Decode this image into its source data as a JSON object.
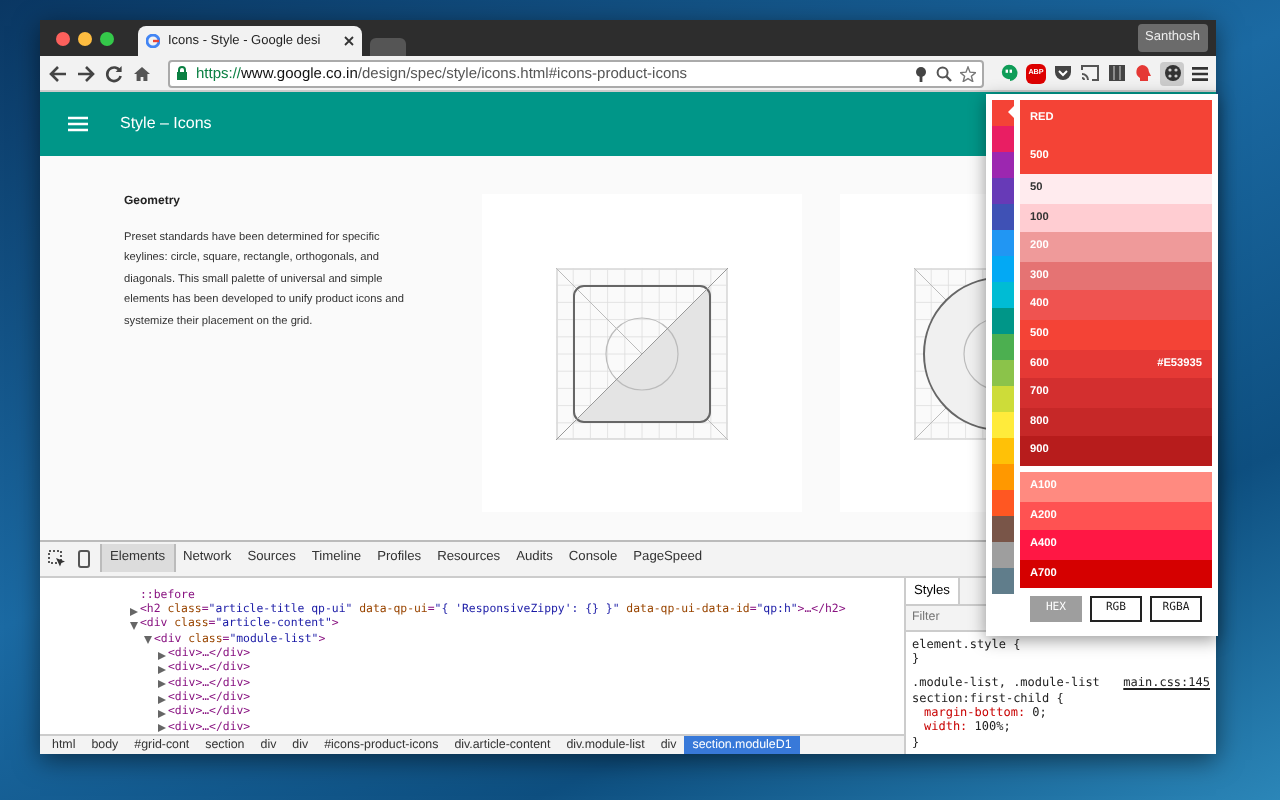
{
  "window": {
    "tab_title": "Icons - Style - Google desi",
    "profile": "Santhosh"
  },
  "toolbar": {
    "url": [
      {
        "kind": "scheme",
        "text": "https://"
      },
      {
        "kind": "host",
        "text": "www.google.co.in"
      },
      {
        "kind": "path",
        "text": "/design/spec/style/icons.html#icons-product-icons"
      }
    ],
    "adblock_badge": "ABP"
  },
  "page": {
    "header_title": "Style – Icons",
    "heading": "Geometry",
    "paragraph": "Preset standards have been determined for specific keylines: circle, square, rectangle, orthogonals, and diagonals. This small palette of universal and simple elements has been developed to unify product icons and systemize their placement on the grid."
  },
  "devtools": {
    "tabs": [
      {
        "label": "Elements",
        "selected": true
      },
      {
        "label": "Network",
        "selected": false
      },
      {
        "label": "Sources",
        "selected": false
      },
      {
        "label": "Timeline",
        "selected": false
      },
      {
        "label": "Profiles",
        "selected": false
      },
      {
        "label": "Resources",
        "selected": false
      },
      {
        "label": "Audits",
        "selected": false
      },
      {
        "label": "Console",
        "selected": false
      },
      {
        "label": "PageSpeed",
        "selected": false
      }
    ],
    "dom_tree": [
      {
        "parts": [
          {
            "kind": "pseudo",
            "text": "::before"
          }
        ]
      },
      {
        "expanded": false,
        "parts": [
          {
            "kind": "tag",
            "text": "<h2"
          },
          {
            "kind": "attr",
            "text": " class"
          },
          {
            "kind": "tag",
            "text": "="
          },
          {
            "kind": "val",
            "text": "\"article-title qp-ui\""
          },
          {
            "kind": "attr",
            "text": " data-qp-ui"
          },
          {
            "kind": "tag",
            "text": "="
          },
          {
            "kind": "val",
            "text": "\"{ 'ResponsiveZippy': {} }\""
          },
          {
            "kind": "attr",
            "text": " data-qp-ui-data-id"
          },
          {
            "kind": "tag",
            "text": "="
          },
          {
            "kind": "val",
            "text": "\"qp:h\""
          },
          {
            "kind": "tag",
            "text": ">…</h2>"
          }
        ]
      },
      {
        "expanded": true,
        "parts": [
          {
            "kind": "tag",
            "text": "<div"
          },
          {
            "kind": "attr",
            "text": " class"
          },
          {
            "kind": "tag",
            "text": "="
          },
          {
            "kind": "val",
            "text": "\"article-content\""
          },
          {
            "kind": "tag",
            "text": ">"
          }
        ],
        "children": [
          {
            "expanded": true,
            "parts": [
              {
                "kind": "tag",
                "text": "<div"
              },
              {
                "kind": "attr",
                "text": " class"
              },
              {
                "kind": "tag",
                "text": "="
              },
              {
                "kind": "val",
                "text": "\"module-list\""
              },
              {
                "kind": "tag",
                "text": ">"
              }
            ],
            "children": [
              {
                "expanded": false,
                "parts": [
                  {
                    "kind": "tag",
                    "text": "<div>…</div>"
                  }
                ]
              },
              {
                "expanded": false,
                "parts": [
                  {
                    "kind": "tag",
                    "text": "<div>…</div>"
                  }
                ]
              },
              {
                "expanded": false,
                "parts": [
                  {
                    "kind": "tag",
                    "text": "<div>…</div>"
                  }
                ]
              },
              {
                "expanded": false,
                "parts": [
                  {
                    "kind": "tag",
                    "text": "<div>…</div>"
                  }
                ]
              },
              {
                "expanded": false,
                "parts": [
                  {
                    "kind": "tag",
                    "text": "<div>…</div>"
                  }
                ]
              },
              {
                "expanded": false,
                "parts": [
                  {
                    "kind": "tag",
                    "text": "<div>…</div>"
                  }
                ]
              }
            ]
          }
        ]
      }
    ],
    "breadcrumbs": [
      {
        "label": "html",
        "selected": false
      },
      {
        "label": "body",
        "selected": false
      },
      {
        "label": "#grid-cont",
        "selected": false
      },
      {
        "label": "section",
        "selected": false
      },
      {
        "label": "div",
        "selected": false
      },
      {
        "label": "div",
        "selected": false
      },
      {
        "label": "#icons-product-icons",
        "selected": false
      },
      {
        "label": "div.article-content",
        "selected": false
      },
      {
        "label": "div.module-list",
        "selected": false
      },
      {
        "label": "div",
        "selected": false
      },
      {
        "label": "section.moduleD1",
        "selected": true
      }
    ],
    "styles": {
      "tab": "Styles",
      "filter_placeholder": "Filter",
      "lines": [
        {
          "kind": "selector",
          "text": "element.style {"
        },
        {
          "kind": "plain",
          "text": "}"
        },
        {
          "kind": "selector",
          "text": ".module-list, .module-list",
          "source": "main.css:145"
        },
        {
          "kind": "selector",
          "text": "section:first-child {"
        },
        {
          "kind": "prop",
          "name": "margin-bottom:",
          "value": "0;"
        },
        {
          "kind": "prop",
          "name": "width:",
          "value": "100%;"
        },
        {
          "kind": "plain",
          "text": "}"
        }
      ]
    }
  },
  "palette": {
    "swatches": [
      {
        "color": "#f44336",
        "selected": true
      },
      {
        "color": "#e91e63",
        "selected": false
      },
      {
        "color": "#9c27b0",
        "selected": false
      },
      {
        "color": "#673ab7",
        "selected": false
      },
      {
        "color": "#3f51b5",
        "selected": false
      },
      {
        "color": "#2196f3",
        "selected": false
      },
      {
        "color": "#03a9f4",
        "selected": false
      },
      {
        "color": "#00bcd4",
        "selected": false
      },
      {
        "color": "#009688",
        "selected": false
      },
      {
        "color": "#4caf50",
        "selected": false
      },
      {
        "color": "#8bc34a",
        "selected": false
      },
      {
        "color": "#cddc39",
        "selected": false
      },
      {
        "color": "#ffeb3b",
        "selected": false
      },
      {
        "color": "#ffc107",
        "selected": false
      },
      {
        "color": "#ff9800",
        "selected": false
      },
      {
        "color": "#ff5722",
        "selected": false
      },
      {
        "color": "#795548",
        "selected": false
      },
      {
        "color": "#9e9e9e",
        "selected": false
      },
      {
        "color": "#607d8b",
        "selected": false
      }
    ],
    "header": {
      "name": "RED",
      "shade": "500",
      "color": "#f44336"
    },
    "shades": [
      {
        "label": "50",
        "color": "#ffebee"
      },
      {
        "label": "100",
        "color": "#ffcdd2"
      },
      {
        "label": "200",
        "color": "#ef9a9a"
      },
      {
        "label": "300",
        "color": "#e57373"
      },
      {
        "label": "400",
        "color": "#ef5350"
      },
      {
        "label": "500",
        "color": "#f44336"
      },
      {
        "label": "600",
        "color": "#e53935",
        "value": "#E53935"
      },
      {
        "label": "700",
        "color": "#d32f2f"
      },
      {
        "label": "800",
        "color": "#c62828"
      },
      {
        "label": "900",
        "color": "#b71c1c"
      }
    ],
    "accents": [
      {
        "label": "A100",
        "color": "#ff8a80"
      },
      {
        "label": "A200",
        "color": "#ff5252"
      },
      {
        "label": "A400",
        "color": "#ff1744"
      },
      {
        "label": "A700",
        "color": "#d50000"
      }
    ],
    "formats": [
      {
        "label": "HEX",
        "selected": true
      },
      {
        "label": "RGB",
        "selected": false
      },
      {
        "label": "RGBA",
        "selected": false
      }
    ]
  }
}
